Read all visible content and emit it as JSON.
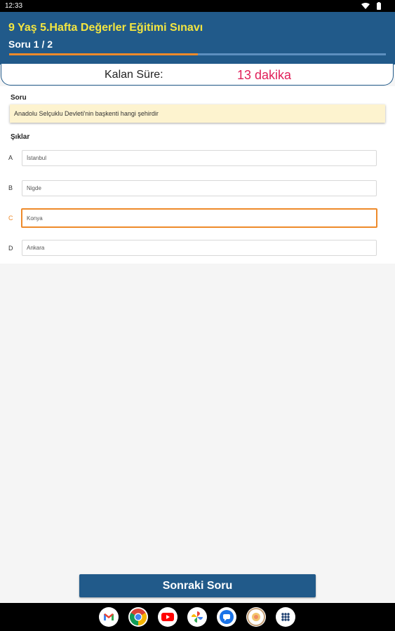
{
  "status_bar": {
    "time": "12:33",
    "icons": [
      "wifi-icon",
      "battery-icon"
    ]
  },
  "header": {
    "title": "9 Yaş 5.Hafta Değerler Eğitimi Sınavı",
    "subtitle": "Soru 1 / 2",
    "progress": 0.5,
    "colors": {
      "background": "#215a8a",
      "title": "#f4e640",
      "progress": "#ee8a2a"
    }
  },
  "timer": {
    "label": "Kalan Süre:",
    "value": "13 dakika",
    "value_color": "#e0205a"
  },
  "question": {
    "label": "Soru",
    "text": "Anadolu Selçuklu Devleti'nin başkenti hangi şehirdir"
  },
  "options": {
    "label": "Şıklar",
    "selected": "C",
    "items": [
      {
        "letter": "A",
        "text": "İstanbul"
      },
      {
        "letter": "B",
        "text": "Nigde"
      },
      {
        "letter": "C",
        "text": "Konya"
      },
      {
        "letter": "D",
        "text": "Ankara"
      }
    ]
  },
  "next_button": {
    "label": "Sonraki Soru"
  },
  "dock": {
    "apps": [
      "gmail-icon",
      "chrome-icon",
      "youtube-icon",
      "photos-icon",
      "messages-icon",
      "camera-icon",
      "app-drawer-icon"
    ]
  }
}
